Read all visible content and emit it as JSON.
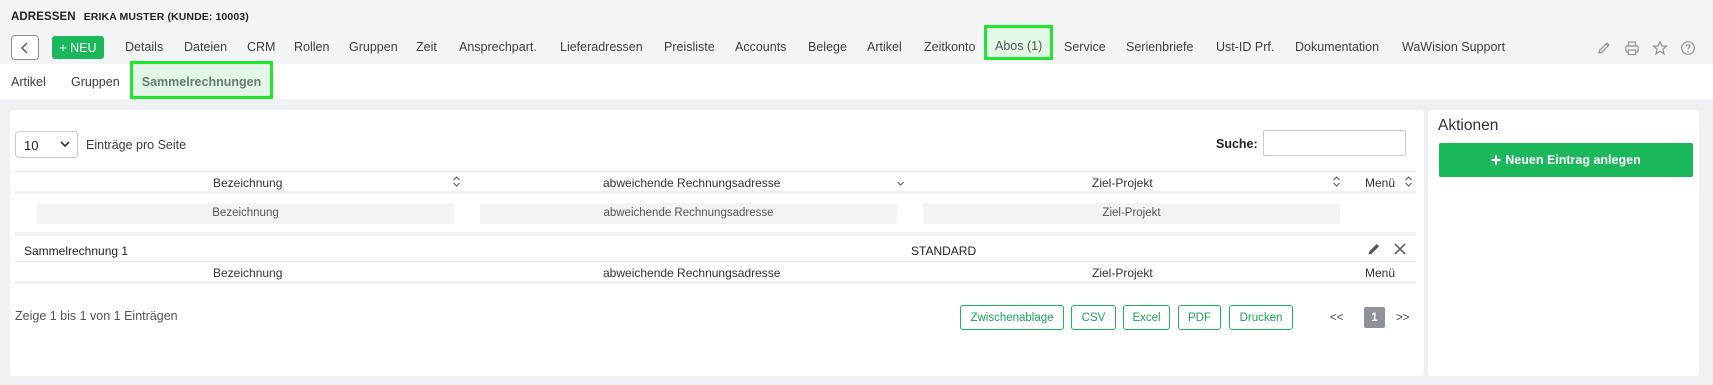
{
  "header": {
    "module": "ADRESSEN",
    "record": "ERIKA MUSTER (KUNDE: 10003)"
  },
  "toolbar": {
    "new_label": "+ NEU",
    "tabs": [
      "Details",
      "Dateien",
      "CRM",
      "Rollen",
      "Gruppen",
      "Zeit",
      "Ansprechpart.",
      "Lieferadressen",
      "Preisliste",
      "Accounts",
      "Belege",
      "Artikel",
      "Zeitkonto",
      "Abos (1)",
      "Service",
      "Serienbriefe",
      "Ust-ID Prf.",
      "Dokumentation",
      "WaWision Support"
    ],
    "highlighted_tab": "Abos (1)",
    "icons": [
      "pencil-icon",
      "printer-icon",
      "star-icon",
      "help-icon"
    ]
  },
  "subnav": {
    "tabs": [
      "Artikel",
      "Gruppen",
      "Sammelrechnungen"
    ],
    "active": "Sammelrechnungen"
  },
  "table": {
    "page_size": "10",
    "page_size_label": "Einträge pro Seite",
    "search_label": "Suche:",
    "search_value": "",
    "columns": [
      "Bezeichnung",
      "abweichende Rechnungsadresse",
      "Ziel-Projekt",
      "Menü"
    ],
    "filters": [
      "Bezeichnung",
      "abweichende Rechnungsadresse",
      "Ziel-Projekt"
    ],
    "rows": [
      {
        "bezeichnung": "Sammelrechnung 1",
        "rechnungsadresse": "",
        "projekt": "STANDARD"
      }
    ],
    "info": "Zeige 1 bis 1 von 1 Einträgen",
    "exports": [
      "Zwischenablage",
      "CSV",
      "Excel",
      "PDF",
      "Drucken"
    ],
    "pagination": {
      "prev": "<<",
      "current": "1",
      "next": ">>"
    }
  },
  "actions": {
    "title": "Aktionen",
    "add_label": "Neuen Eintrag anlegen"
  },
  "colors": {
    "accent": "#1ab85b",
    "highlight_outline": "#22e52e",
    "highlight_fill": "#e3f7e6",
    "page_bg": "#eef0f3"
  }
}
